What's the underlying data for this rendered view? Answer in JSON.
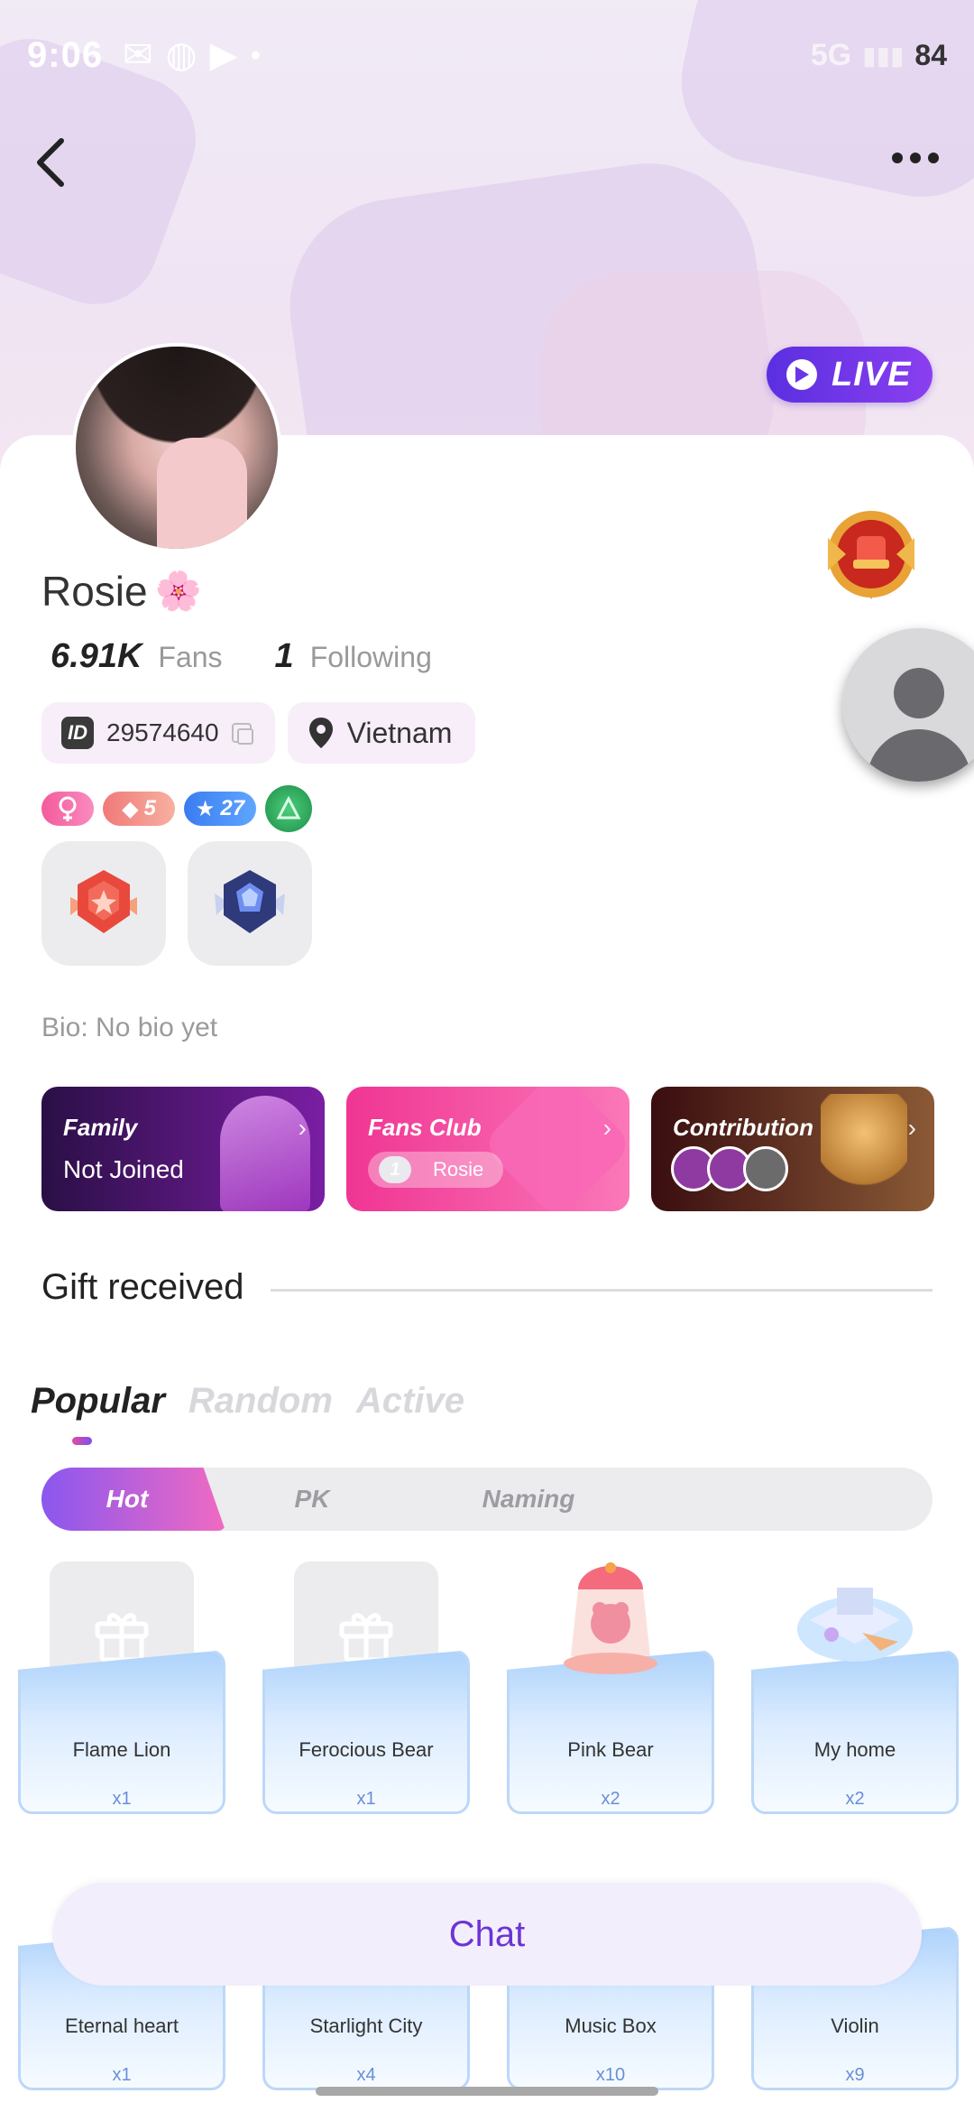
{
  "status_bar": {
    "time": "9:06",
    "network": "5G",
    "battery": "84"
  },
  "header": {
    "live_label": "LIVE"
  },
  "profile": {
    "name": "Rosie",
    "name_emoji": "🌸",
    "fans_count": "6.91K",
    "fans_label": "Fans",
    "following_count": "1",
    "following_label": "Following",
    "id_icon": "ID",
    "id_value": "29574640",
    "location": "Vietnam",
    "badges": {
      "diamond_level": "5",
      "star_level": "27"
    },
    "bio": "Bio: No bio yet"
  },
  "feature_cards": {
    "family": {
      "title": "Family",
      "subtitle": "Not Joined"
    },
    "fans_club": {
      "title": "Fans Club",
      "member_name": "Rosie",
      "level": "1"
    },
    "contribution": {
      "title": "Contribution",
      "ranks": [
        "1",
        "2",
        "3"
      ]
    }
  },
  "gifts_section": {
    "title": "Gift received",
    "tabs": [
      "Popular",
      "Random",
      "Active"
    ],
    "subtabs": [
      "Hot",
      "PK",
      "Naming"
    ],
    "items": [
      {
        "name": "Flame Lion",
        "count": "x1"
      },
      {
        "name": "Ferocious Bear",
        "count": "x1"
      },
      {
        "name": "Pink Bear",
        "count": "x2"
      },
      {
        "name": "My home",
        "count": "x2"
      },
      {
        "name": "Eternal heart",
        "count": "x1"
      },
      {
        "name": "Starlight City",
        "count": "x4"
      },
      {
        "name": "Music Box",
        "count": "x10"
      },
      {
        "name": "Violin",
        "count": "x9"
      }
    ]
  },
  "chat_button": {
    "label": "Chat"
  },
  "colors": {
    "accent": "#6b34d6",
    "live": "#5a2fe0",
    "fans_club": "#f03593"
  }
}
